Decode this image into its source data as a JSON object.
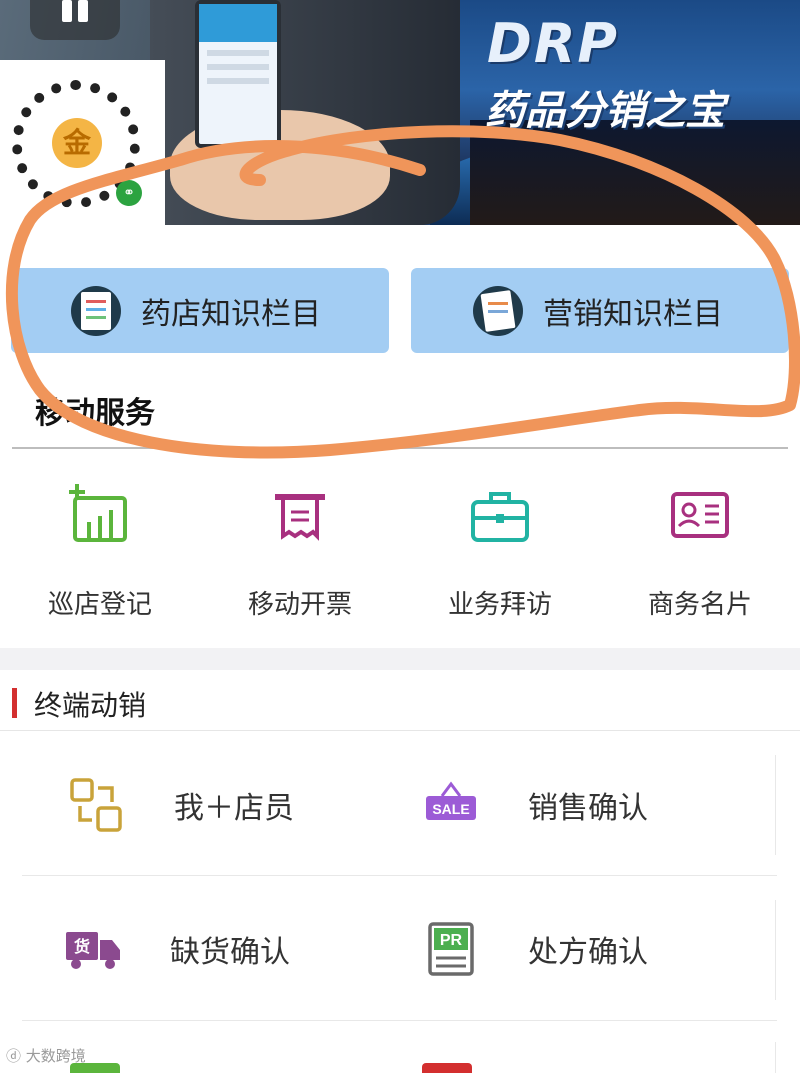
{
  "banner": {
    "title": "DRP",
    "subtitle": "药品分销之宝",
    "qr_center_glyph": "金"
  },
  "knowledge_buttons": [
    {
      "label": "药店知识栏目",
      "icon": "calendar-list-icon"
    },
    {
      "label": "营销知识栏目",
      "icon": "documents-icon"
    }
  ],
  "mobile_services": {
    "title": "移动服务",
    "items": [
      {
        "label": "巡店登记",
        "icon": "chart-plus-icon",
        "color": "#5bb53c"
      },
      {
        "label": "移动开票",
        "icon": "receipt-icon",
        "color": "#a8307f"
      },
      {
        "label": "业务拜访",
        "icon": "briefcase-icon",
        "color": "#21b3a3"
      },
      {
        "label": "商务名片",
        "icon": "id-card-icon",
        "color": "#a8307f"
      }
    ]
  },
  "terminal": {
    "title": "终端动销",
    "accent": "#d32f2f",
    "items": [
      {
        "label": "我＋店员",
        "icon": "exchange-icon",
        "color": "#c9a33a"
      },
      {
        "label": "销售确认",
        "icon": "sale-sign-icon",
        "color": "#9c5bd6",
        "badge": "SALE"
      },
      {
        "label": "缺货确认",
        "icon": "delivery-truck-icon",
        "color": "#8b4a8f",
        "badge": "货"
      },
      {
        "label": "处方确认",
        "icon": "prescription-icon",
        "color": "#6a6a6a",
        "badge": "PR"
      }
    ]
  },
  "annotation_color": "#f0955a",
  "watermark": "大数跨境"
}
